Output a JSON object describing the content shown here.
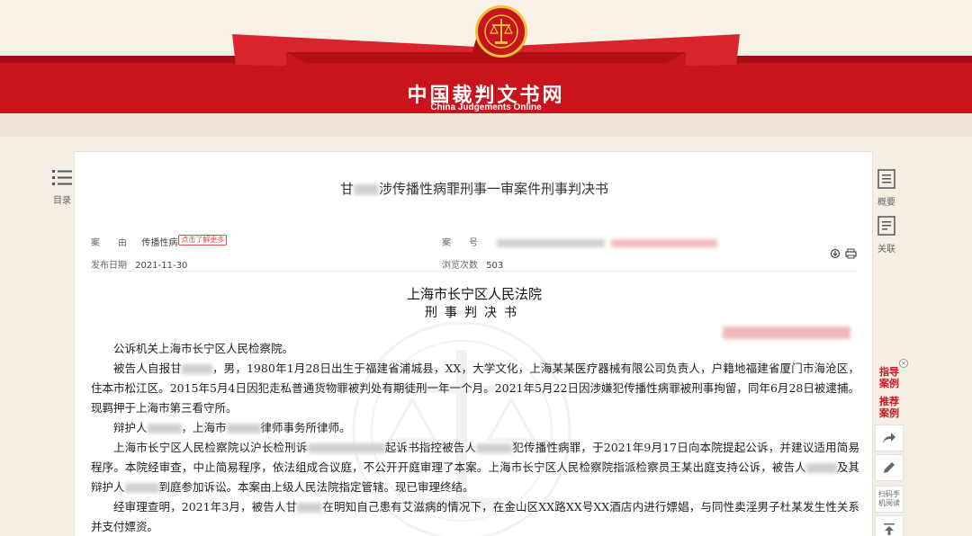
{
  "site": {
    "title": "中国裁判文书网",
    "subtitle": "China Judgements Online"
  },
  "left_tool": {
    "toc_label": "目录"
  },
  "right_tools": {
    "summary_label": "概要",
    "related_label": "关联"
  },
  "side_panel": {
    "guiding_cases": "指导案例",
    "recommended_cases": "推荐案例",
    "close_symbol": "×",
    "qr_label": "扫码手机阅读"
  },
  "doc": {
    "title_prefix": "甘",
    "title_suffix": "涉传播性病罪刑事一审案件刑事判决书",
    "cause_key": "案　　由",
    "cause_value": "传播性病",
    "more_tag": "点击了解更多",
    "case_no_key": "案　　号",
    "publish_key": "发布日期",
    "publish_value": "2021-11-30",
    "views_key": "浏览次数",
    "views_value": "503",
    "court": "上海市长宁区人民法院",
    "doc_type": "刑事判决书"
  },
  "body": {
    "p1": "公诉机关上海市长宁区人民检察院。",
    "p2_a": "被告人自报甘",
    "p2_b": "，男，1980年1月28日出生于福建省浦城县，XX，大学文化，上海某某医疗器械有限公司负责人，户籍地福建省厦门市海沧区，住本市松江区。2015年5月4日因犯走私普通货物罪被判处有期徒刑一年一个月。2021年5月22日因涉嫌犯传播性病罪被刑事拘留，同年6月28日被逮捕。现羁押于上海市第三看守所。",
    "p3_a": "辩护人",
    "p3_b": "，上海市",
    "p3_c": "律师事务所律师。",
    "p4_a": "上海市长宁区人民检察院以沪长检刑诉",
    "p4_b": "起诉书指控被告人",
    "p4_c": "犯传播性病罪，于2021年9月17日向本院提起公诉，并建议适用简易程序。本院经审查，中止简易程序，依法组成合议庭，不公开开庭审理了本案。上海市长宁区人民检察院指派检察员王某出庭支持公诉，被告人",
    "p4_d": "及其辩护人",
    "p4_e": "到庭参加诉讼。本案由上级人民法院指定管辖。现已审理终结。",
    "p5_a": "经审理查明，2021年3月，被告人甘",
    "p5_b": "在明知自己患有艾滋病的情况下，在金山区XX路XX号XX酒店内进行嫖娼，与同性卖淫男子杜某发生性关系并支付嫖资。"
  },
  "colors": {
    "brand_red": "#c8141c",
    "gold": "#f0c23a",
    "background": "#f4eee4"
  }
}
